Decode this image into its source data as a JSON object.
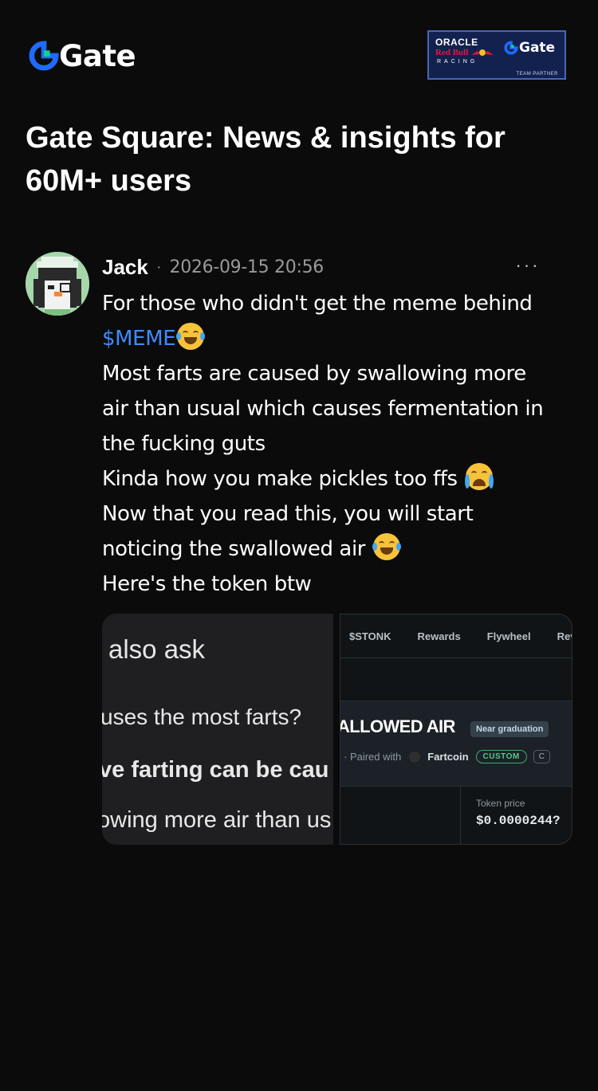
{
  "header": {
    "logo_text": "Gate",
    "partner": {
      "oracle": "ORACLE",
      "redbull": "Red Bull",
      "racing": "RACING",
      "gate": "Gate",
      "team_partner": "TEAM PARTNER"
    }
  },
  "page_title": "Gate Square: News & insights for 60M+ users",
  "post": {
    "author": "Jack",
    "separator": "·",
    "timestamp": "2026-09-15 20:56",
    "more_label": "···",
    "lines": {
      "l1": "For those who didn't get the meme behind",
      "cashtag": "$MEME",
      "l3": "Most farts are caused by swallowing more",
      "l4": "air than usual which causes fermentation in",
      "l5": "the fucking guts",
      "l6": "Kinda how you make pickles too ffs ",
      "l7": "Now that you read this, you will start",
      "l8": "noticing the swallowed air ",
      "l9": "Here's the token btw"
    },
    "media": {
      "left": {
        "heading": "also ask",
        "question": "uses the most farts?",
        "bold_answer": "ve farting can be cau",
        "answer": "owing more air than us"
      },
      "right": {
        "tabs": [
          "$STONK",
          "Rewards",
          "Flywheel",
          "Rev"
        ],
        "token_name": "ALLOWED AIR",
        "badge": "Near graduation",
        "paired_prefix": "· Paired with",
        "paired_token": "Fartcoin",
        "custom_label": "CUSTOM",
        "cut_label": "C",
        "price_label": "Token price",
        "price_value": "$0.0000244?"
      }
    }
  },
  "colors": {
    "background": "#0b0b0b",
    "cashtag": "#3d8bff",
    "brand_blue": "#1f6bff",
    "brand_green": "#12d18e"
  }
}
